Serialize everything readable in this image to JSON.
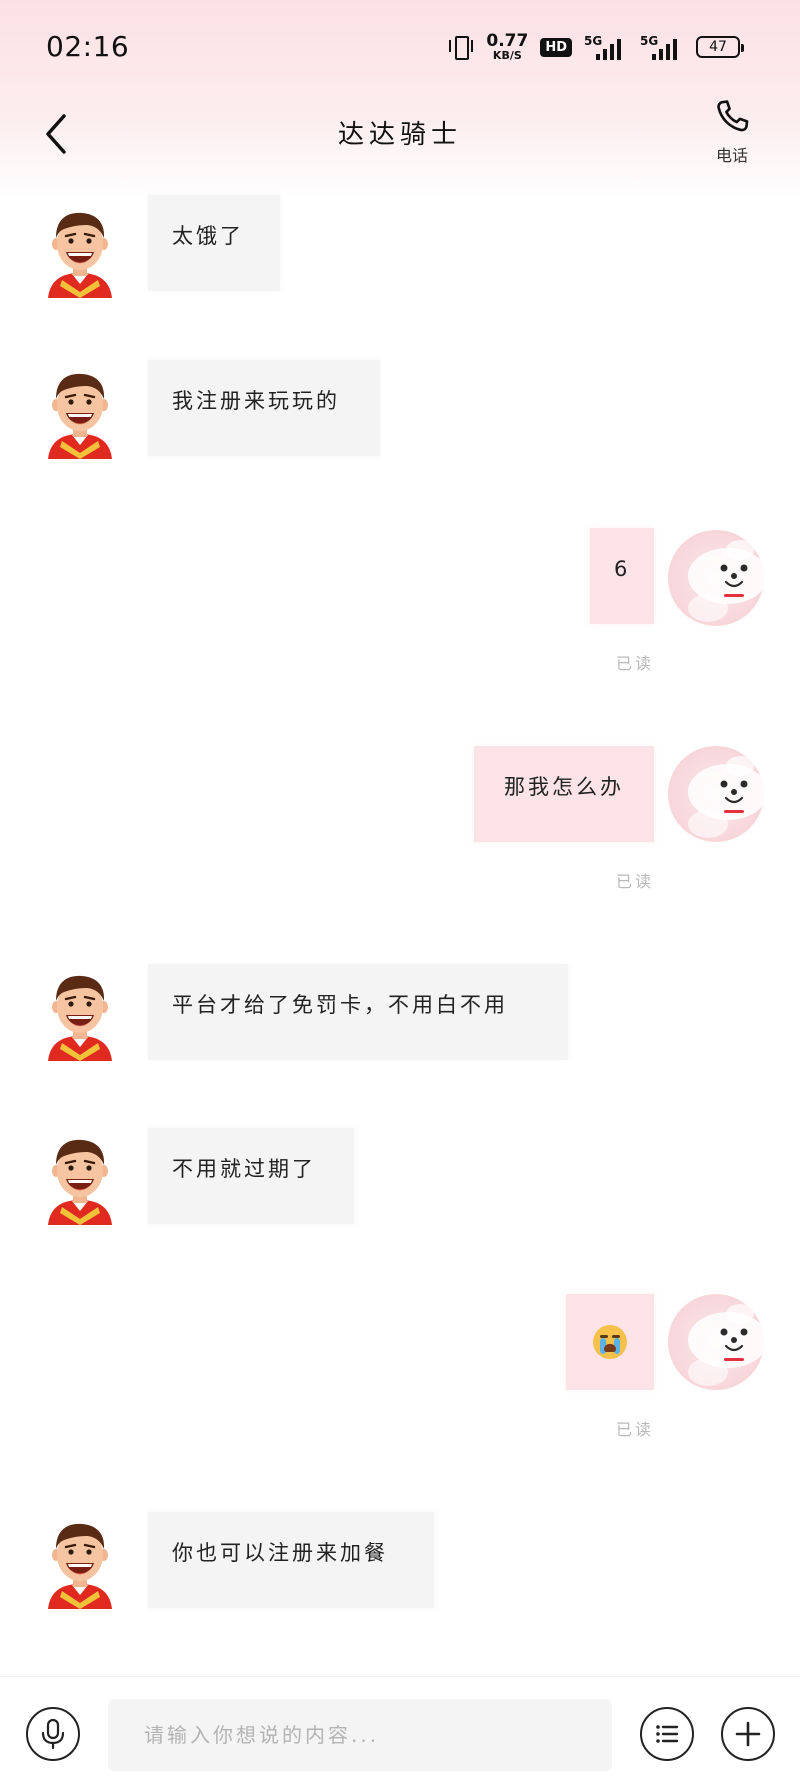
{
  "status_bar": {
    "time": "02:16",
    "net_speed_value": "0.77",
    "net_speed_unit": "KB/S",
    "hd_badge": "HD",
    "signal_1": "5G",
    "signal_2": "5G",
    "battery": "47"
  },
  "header": {
    "title": "达达骑士",
    "phone_label": "电话",
    "icons": [
      "chevron-left-icon",
      "phone-icon"
    ]
  },
  "messages": [
    {
      "side": "left",
      "text": "太饿了",
      "avatar": "rider-avatar"
    },
    {
      "side": "left",
      "text": "我注册来玩玩的",
      "avatar": "rider-avatar"
    },
    {
      "side": "right",
      "text": "6",
      "avatar": "mascot-avatar",
      "status": "已读"
    },
    {
      "side": "right",
      "text": "那我怎么办",
      "avatar": "mascot-avatar",
      "status": "已读"
    },
    {
      "side": "left",
      "text": "平台才给了免罚卡，不用白不用",
      "avatar": "rider-avatar"
    },
    {
      "side": "left",
      "text": "不用就过期了",
      "avatar": "rider-avatar"
    },
    {
      "side": "right",
      "emoji": "loudly-crying-face",
      "avatar": "mascot-avatar",
      "status": "已读"
    },
    {
      "side": "left",
      "text": "你也可以注册来加餐",
      "avatar": "rider-avatar"
    }
  ],
  "input_bar": {
    "placeholder": "请输入你想说的内容...",
    "value": "",
    "icons": [
      "microphone-icon",
      "list-icon",
      "plus-icon"
    ]
  },
  "colors": {
    "header_gradient_top": "#fbe1e4",
    "left_bubble": "#f4f4f4",
    "right_bubble": "#fbe3e7",
    "read_status": "#b9b9b9",
    "rider_shirt": "#e02a20"
  }
}
